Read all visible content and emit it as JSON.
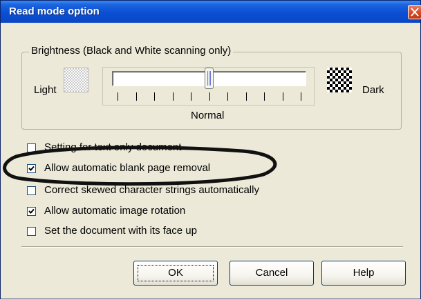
{
  "window": {
    "title": "Read mode option"
  },
  "brightness": {
    "group_label": "Brightness (Black and White scanning only)",
    "light_label": "Light",
    "dark_label": "Dark",
    "center_label": "Normal",
    "slider_value": 0.5,
    "tick_count": 11
  },
  "options": [
    {
      "label": "Setting for text only document",
      "checked": false
    },
    {
      "label": "Allow automatic blank page removal",
      "checked": true
    },
    {
      "label": "Correct skewed character strings automatically",
      "checked": false
    },
    {
      "label": "Allow automatic image rotation",
      "checked": true
    },
    {
      "label": "Set the document with its face up",
      "checked": false
    }
  ],
  "buttons": {
    "ok": "OK",
    "cancel": "Cancel",
    "help": "Help"
  },
  "colors": {
    "titlebar": "#0a4fd4",
    "dialog_background": "#ece9d8",
    "close_button": "#d5451f",
    "annotation_ellipse": "#000000"
  },
  "icons": {
    "close": "close-icon",
    "light": "light-pattern-icon",
    "dark": "dark-pattern-icon",
    "check": "checkmark-icon"
  }
}
